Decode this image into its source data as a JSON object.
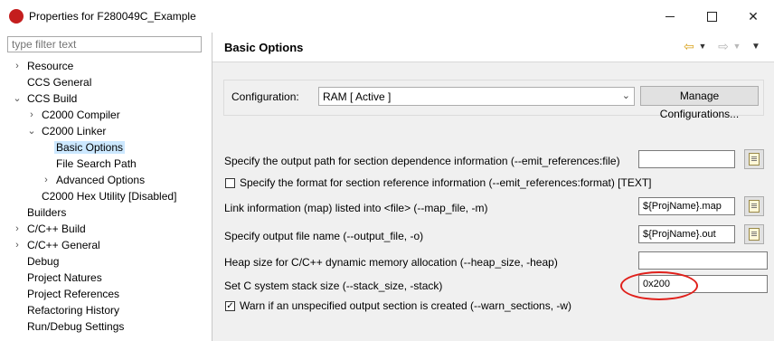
{
  "window": {
    "title": "Properties for F280049C_Example"
  },
  "filter": {
    "placeholder": "type filter text"
  },
  "tree": [
    {
      "label": "Resource",
      "expander": "›"
    },
    {
      "label": "CCS General",
      "expander": ""
    },
    {
      "label": "CCS Build",
      "expander": "⌄"
    },
    {
      "label": "C2000 Compiler",
      "expander": "›"
    },
    {
      "label": "C2000 Linker",
      "expander": "⌄"
    },
    {
      "label": "Basic Options",
      "expander": ""
    },
    {
      "label": "File Search Path",
      "expander": ""
    },
    {
      "label": "Advanced Options",
      "expander": "›"
    },
    {
      "label": "C2000 Hex Utility  [Disabled]",
      "expander": ""
    },
    {
      "label": "Builders",
      "expander": ""
    },
    {
      "label": "C/C++ Build",
      "expander": "›"
    },
    {
      "label": "C/C++ General",
      "expander": "›"
    },
    {
      "label": "Debug",
      "expander": ""
    },
    {
      "label": "Project Natures",
      "expander": ""
    },
    {
      "label": "Project References",
      "expander": ""
    },
    {
      "label": "Refactoring History",
      "expander": ""
    },
    {
      "label": "Run/Debug Settings",
      "expander": ""
    }
  ],
  "page": {
    "title": "Basic Options"
  },
  "config": {
    "label": "Configuration:",
    "value": "RAM  [ Active ]",
    "manage_button": "Manage Configurations..."
  },
  "options": {
    "emit_refs_file": {
      "label": "Specify the output path for section dependence information (--emit_references:file)",
      "value": ""
    },
    "emit_refs_format": {
      "label": "Specify the format for section reference information (--emit_references:format) [TEXT]",
      "checked": false
    },
    "map_file": {
      "label": "Link information (map) listed into <file> (--map_file, -m)",
      "value": "${ProjName}.map"
    },
    "output_file": {
      "label": "Specify output file name (--output_file, -o)",
      "value": "${ProjName}.out"
    },
    "heap_size": {
      "label": "Heap size for C/C++ dynamic memory allocation (--heap_size, -heap)",
      "value": ""
    },
    "stack_size": {
      "label": "Set C system stack size (--stack_size, -stack)",
      "value": "0x200"
    },
    "warn_sections": {
      "label": "Warn if an unspecified output section is created (--warn_sections, -w)",
      "checked": true
    }
  },
  "icons": {
    "back": "back-arrow-icon",
    "forward": "forward-arrow-icon",
    "menu": "view-menu-icon",
    "browse": "variables-icon"
  },
  "colors": {
    "selection": "#cce8ff",
    "annotation_circle": "#e0201b",
    "app_icon": "#c41e1e"
  }
}
